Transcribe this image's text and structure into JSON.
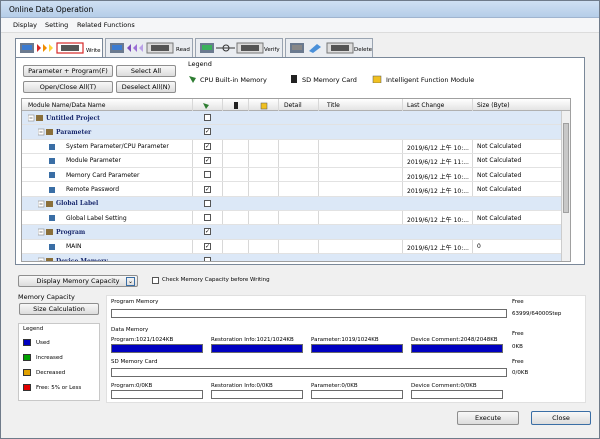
{
  "window": {
    "title": "Online Data Operation"
  },
  "menu": [
    "Display",
    "Setting",
    "Related Functions"
  ],
  "tabs": [
    {
      "label": "Write"
    },
    {
      "label": "Read"
    },
    {
      "label": "Verify"
    },
    {
      "label": "Delete"
    }
  ],
  "buttons": {
    "param_prog": "Parameter + Program(F)",
    "select_all": "Select All",
    "open_close": "Open/Close All(T)",
    "deselect": "Deselect All(N)",
    "display_capacity": "Display Memory Capacity",
    "size_calc": "Size Calculation",
    "execute": "Execute",
    "close": "Close"
  },
  "legend": {
    "title": "Legend",
    "items": [
      "CPU Built-in Memory",
      "SD Memory Card",
      "Intelligent Function Module"
    ]
  },
  "columns": [
    "Module Name/Data Name",
    "Detail",
    "Title",
    "Last Change",
    "Size (Byte)"
  ],
  "rows": [
    {
      "name": "Untitled Project",
      "group": true,
      "cb": "empty",
      "last": "",
      "size": ""
    },
    {
      "name": "Parameter",
      "group": true,
      "cb": "check",
      "last": "",
      "size": ""
    },
    {
      "name": "System Parameter/CPU Parameter",
      "cb": "check",
      "last": "2019/6/12 上午 10:...",
      "size": "Not Calculated"
    },
    {
      "name": "Module Parameter",
      "cb": "check",
      "last": "2019/6/12 上午 11:...",
      "size": "Not Calculated"
    },
    {
      "name": "Memory Card Parameter",
      "cb": "empty",
      "last": "2019/6/12 上午 10:...",
      "size": "Not Calculated"
    },
    {
      "name": "Remote Password",
      "cb": "check",
      "last": "2019/6/12 上午 10:...",
      "size": "Not Calculated"
    },
    {
      "name": "Global Label",
      "group": true,
      "cb": "empty",
      "last": "",
      "size": ""
    },
    {
      "name": "Global Label Setting",
      "cb": "empty",
      "last": "2019/6/12 上午 10:...",
      "size": "Not Calculated"
    },
    {
      "name": "Program",
      "group": true,
      "cb": "check",
      "last": "",
      "size": ""
    },
    {
      "name": "MAIN",
      "cb": "check",
      "last": "2019/6/12 上午 10:...",
      "size": "0"
    },
    {
      "name": "Device Memory",
      "group": true,
      "cb": "empty",
      "last": "",
      "size": ""
    }
  ],
  "check_capacity": "Check Memory Capacity before Writing",
  "memcap": {
    "title": "Memory Capacity",
    "legend_title": "Legend",
    "legend": [
      {
        "label": "Used",
        "color": "#0000c0"
      },
      {
        "label": "Increased",
        "color": "#00a000"
      },
      {
        "label": "Decreased",
        "color": "#e0a000"
      },
      {
        "label": "Free: 5% or Less",
        "color": "#e00000"
      }
    ]
  },
  "program_memory": {
    "label": "Program Memory",
    "free_label": "Free",
    "free": "63999/64000Step"
  },
  "data_memory": {
    "label": "Data Memory",
    "free_label": "Free",
    "free": "0KB",
    "program": "Program:1021/1024KB",
    "restore": "Restoration Info:1021/1024KB",
    "param": "Parameter:1019/1024KB",
    "comment": "Device Comment:2048/2048KB"
  },
  "sd_card": {
    "label": "SD Memory Card",
    "free_label": "Free",
    "free": "0/0KB",
    "program": "Program:0/0KB",
    "restore": "Restoration Info:0/0KB",
    "param": "Parameter:0/0KB",
    "comment": "Device Comment:0/0KB"
  }
}
